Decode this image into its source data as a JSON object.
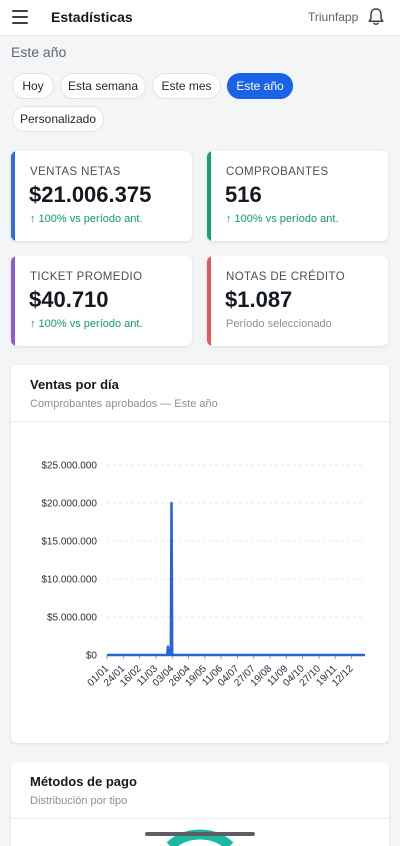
{
  "header": {
    "title": "Estadísticas",
    "brand": "Triunfapp"
  },
  "period_label": "Este año",
  "filters": [
    {
      "label": "Hoy",
      "active": false
    },
    {
      "label": "Esta semana",
      "active": false
    },
    {
      "label": "Este mes",
      "active": false
    },
    {
      "label": "Este año",
      "active": true
    },
    {
      "label": "Personalizado",
      "active": false
    }
  ],
  "kpis": [
    {
      "label": "VENTAS NETAS",
      "value": "$21.006.375",
      "sub": "↑ 100% vs período ant.",
      "accent": "#2e6be6",
      "trend": "up"
    },
    {
      "label": "COMPROBANTES",
      "value": "516",
      "sub": "↑ 100% vs período ant.",
      "accent": "#12a36b",
      "trend": "up"
    },
    {
      "label": "TICKET PROMEDIO",
      "value": "$40.710",
      "sub": "↑ 100% vs período ant.",
      "accent": "#8b5cd6",
      "trend": "up"
    },
    {
      "label": "NOTAS DE CRÉDITO",
      "value": "$1.087",
      "sub": "Período seleccionado",
      "accent": "#e05c5c",
      "trend": "none"
    }
  ],
  "sales_card": {
    "title": "Ventas por día",
    "subtitle": "Comprobantes aprobados — Este año"
  },
  "payments_card": {
    "title": "Métodos de pago",
    "subtitle": "Distribución por tipo"
  },
  "colors": {
    "primary": "#1a62e8",
    "line": "#2563d6",
    "up": "#0f9d63",
    "muted": "#8a8f99"
  },
  "chart_data": {
    "type": "line",
    "title": "Ventas por día",
    "subtitle": "Comprobantes aprobados — Este año",
    "ylim": [
      0,
      25000000
    ],
    "y_ticks": [
      {
        "value": 0,
        "label": "$0"
      },
      {
        "value": 5000000,
        "label": "$5.000.000"
      },
      {
        "value": 10000000,
        "label": "$10.000.000"
      },
      {
        "value": 15000000,
        "label": "$15.000.000"
      },
      {
        "value": 20000000,
        "label": "$20.000.000"
      },
      {
        "value": 25000000,
        "label": "$25.000.000"
      }
    ],
    "x_tick_labels": [
      "01/01",
      "24/01",
      "16/02",
      "11/03",
      "03/04",
      "26/04",
      "19/05",
      "11/06",
      "04/07",
      "27/07",
      "19/08",
      "11/09",
      "04/10",
      "27/10",
      "19/11",
      "12/12"
    ],
    "x_domain": [
      "01/01",
      "31/12"
    ],
    "series": [
      {
        "values": [
          {
            "x": "01/01",
            "y": 0
          },
          {
            "x": "27/03",
            "y": 0
          },
          {
            "x": "28/03",
            "y": 1100000
          },
          {
            "x": "29/03",
            "y": 0
          },
          {
            "x": "01/04",
            "y": 0
          },
          {
            "x": "02/04",
            "y": 20000000
          },
          {
            "x": "03/04",
            "y": 0
          },
          {
            "x": "31/12",
            "y": 0
          }
        ]
      }
    ],
    "grid": true,
    "legend": "none"
  }
}
